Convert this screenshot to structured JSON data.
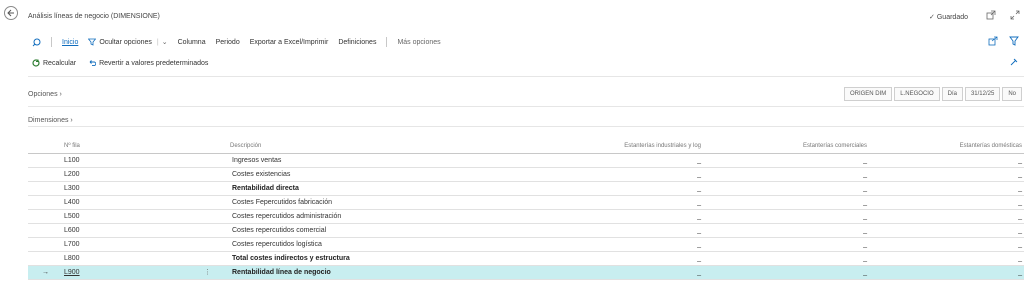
{
  "window": {
    "title": "Análisis líneas de negocio (DIMENSIONE)",
    "saved_label": "Guardado"
  },
  "actions": {
    "search_icon": "search-icon",
    "home": "Inicio",
    "hide_options": "Ocultar opciones",
    "column": "Columna",
    "period": "Periodo",
    "export": "Exportar a Excel/Imprimir",
    "definitions": "Definiciones",
    "more": "Más opciones"
  },
  "toolbar": {
    "recalc": "Recalcular",
    "revert": "Revertir a valores predeterminados"
  },
  "options": {
    "label": "Opciones",
    "pills": [
      "ORIGEN DIM",
      "L.NEGOCIO",
      "Día",
      "31/12/25",
      "No"
    ]
  },
  "dimensions": {
    "label": "Dimensiones"
  },
  "grid": {
    "headers": {
      "row_no": "Nº fila",
      "description": "Descripción",
      "col1": "Estanterías industriales y log",
      "col2": "Estanterías comerciales",
      "col3": "Estanterías domésticas"
    },
    "rows": [
      {
        "no": "L100",
        "desc": "Ingresos ventas",
        "bold": false,
        "v1": "_",
        "v2": "_",
        "v3": "_"
      },
      {
        "no": "L200",
        "desc": "Costes existencias",
        "bold": false,
        "v1": "_",
        "v2": "_",
        "v3": "_"
      },
      {
        "no": "L300",
        "desc": "Rentabilidad directa",
        "bold": true,
        "v1": "_",
        "v2": "_",
        "v3": "_"
      },
      {
        "no": "L400",
        "desc": "Costes Fepercutidos fabricación",
        "bold": false,
        "v1": "_",
        "v2": "_",
        "v3": "_"
      },
      {
        "no": "L500",
        "desc": "Costes repercutidos administración",
        "bold": false,
        "v1": "_",
        "v2": "_",
        "v3": "_"
      },
      {
        "no": "L600",
        "desc": "Costes repercutidos comercial",
        "bold": false,
        "v1": "_",
        "v2": "_",
        "v3": "_"
      },
      {
        "no": "L700",
        "desc": "Costes repercutidos logística",
        "bold": false,
        "v1": "_",
        "v2": "_",
        "v3": "_"
      },
      {
        "no": "L800",
        "desc": "Total costes indirectos y estructura",
        "bold": true,
        "v1": "_",
        "v2": "_",
        "v3": "_"
      },
      {
        "no": "L900",
        "desc": "Rentabilidad línea de negocio",
        "bold": true,
        "v1": "_",
        "v2": "_",
        "v3": "_",
        "selected": true
      }
    ]
  },
  "colors": {
    "accent": "#0f6cbd",
    "selected_row": "#c8eef0",
    "recalc_icon": "#2e7d32"
  }
}
